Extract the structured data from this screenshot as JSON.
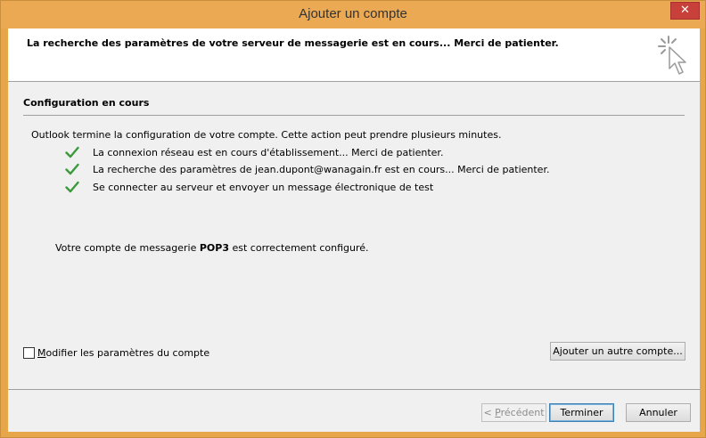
{
  "window": {
    "title": "Ajouter un compte",
    "close_glyph": "✕"
  },
  "header": {
    "message": "La recherche des paramètres de votre serveur de messagerie est en cours... Merci de patienter."
  },
  "section": {
    "title": "Configuration en cours",
    "intro": "Outlook termine la configuration de votre compte. Cette action peut prendre plusieurs minutes.",
    "steps": [
      {
        "label": "La connexion réseau est en cours d'établissement... Merci de patienter.",
        "status": "done"
      },
      {
        "label": "La recherche des paramètres de jean.dupont@wanagain.fr est en cours... Merci de patienter.",
        "status": "done"
      },
      {
        "label": "Se connecter au serveur et envoyer un message électronique de test",
        "status": "done"
      }
    ],
    "result_prefix": "Votre compte de messagerie ",
    "result_bold": "POP3",
    "result_suffix": " est correctement configuré."
  },
  "options": {
    "modify_settings_label_mnemonic": "M",
    "modify_settings_label_rest": "odifier les paramètres du compte",
    "modify_settings_checked": false,
    "add_another_label": "Ajouter un autre compte..."
  },
  "footer": {
    "prev_label_prefix": "< ",
    "prev_label_mnemonic": "P",
    "prev_label_rest": "récédent",
    "finish_label": "Terminer",
    "cancel_label": "Annuler"
  },
  "colors": {
    "titlebar": "#eaa952",
    "close": "#c7403a",
    "check": "#3c9a3c"
  }
}
